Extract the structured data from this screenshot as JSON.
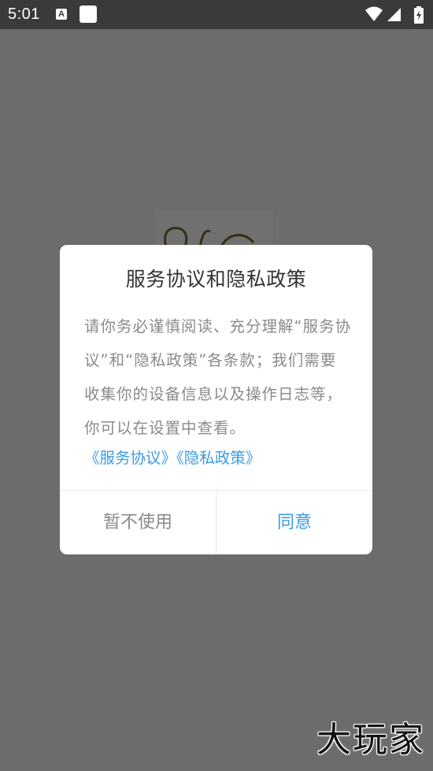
{
  "status_bar": {
    "time": "5:01",
    "notification_icon_letter": "A"
  },
  "dialog": {
    "title": "服务协议和隐私政策",
    "body": "请你务必谨慎阅读、充分理解“服务协议”和“隐私政策”各条款；我们需要收集你的设备信息以及操作日志等，你可以在设置中查看。",
    "link_service": "《服务协议》",
    "link_privacy": "《隐私政策》",
    "decline_label": "暂不使用",
    "agree_label": "同意"
  },
  "watermark": "大玩家",
  "colors": {
    "link": "#3a9be6",
    "overlay": "#6c6c6c",
    "status_bar": "#3a3a3a"
  }
}
